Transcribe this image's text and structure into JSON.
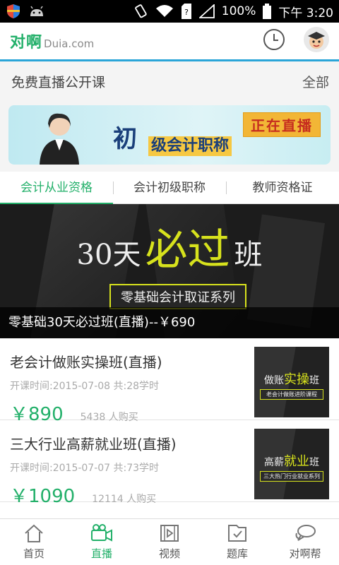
{
  "statusbar": {
    "battery": "100%",
    "time": "下午 3:20"
  },
  "app": {
    "logo_cn": "对啊",
    "logo_en": "Duia.com"
  },
  "section": {
    "title": "免费直播公开课",
    "all_label": "全部"
  },
  "banner": {
    "big": "初",
    "sub": "级会计职称",
    "live": "正在直播"
  },
  "tabs": [
    {
      "label": "会计从业资格",
      "active": true
    },
    {
      "label": "会计初级职称",
      "active": false
    },
    {
      "label": "教师资格证",
      "active": false
    }
  ],
  "hero": {
    "head_a": "30天",
    "head_b": "必过",
    "head_c": "班",
    "tag": "零基础会计取证系列",
    "caption": "零基础30天必过班(直播)--￥690"
  },
  "courses": [
    {
      "name": "老会计做账实操班(直播)",
      "meta": "开课时间:2015-07-08 共:28学时",
      "price": "￥890",
      "buyers": "5438 人购买",
      "thumb_a": "做账",
      "thumb_b": "实操",
      "thumb_c": "班",
      "thumb_tag": "老会计做账进阶课程"
    },
    {
      "name": "三大行业高薪就业班(直播)",
      "meta": "开课时间:2015-07-07 共:73学时",
      "price": "￥1090",
      "buyers": "12114 人购买",
      "thumb_a": "高薪",
      "thumb_b": "就业",
      "thumb_c": "班",
      "thumb_tag": "三大热门行业就业系列"
    }
  ],
  "bottomnav": [
    {
      "label": "首页",
      "icon": "home-icon"
    },
    {
      "label": "直播",
      "icon": "live-camera-icon",
      "active": true
    },
    {
      "label": "视频",
      "icon": "video-icon"
    },
    {
      "label": "题库",
      "icon": "question-bank-icon"
    },
    {
      "label": "对啊帮",
      "icon": "chat-bubble-icon"
    }
  ],
  "colors": {
    "accent": "#23b06a",
    "appbar_line": "#2aa5d8",
    "highlight": "#d7e21d"
  }
}
